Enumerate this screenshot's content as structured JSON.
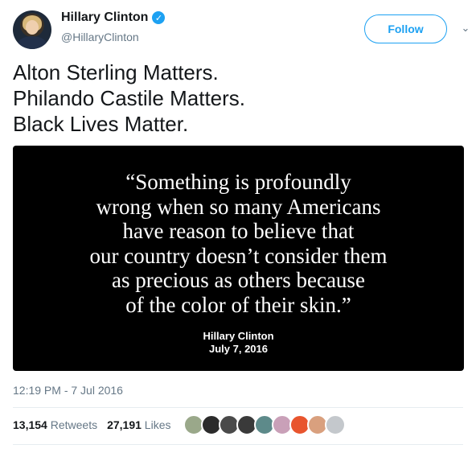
{
  "user": {
    "display_name": "Hillary Clinton",
    "handle": "@HillaryClinton",
    "verified_glyph": "✓"
  },
  "actions": {
    "follow_label": "Follow",
    "more_glyph": "⌄"
  },
  "tweet": {
    "lines": [
      "Alton Sterling Matters.",
      "Philando Castile Matters.",
      "Black Lives Matter."
    ]
  },
  "media": {
    "quote_lines": [
      "“Something is profoundly",
      "wrong when so many Americans",
      "have reason to believe that",
      "our country doesn’t consider them",
      "as precious as others because",
      "of the color of their skin.”"
    ],
    "attribution_name": "Hillary Clinton",
    "attribution_date": "July 7, 2016"
  },
  "meta": {
    "timestamp": "12:19 PM - 7 Jul 2016"
  },
  "stats": {
    "retweets_count": "13,154",
    "retweets_label": "Retweets",
    "likes_count": "27,191",
    "likes_label": "Likes"
  },
  "likers": {
    "colors": [
      "#9aa88a",
      "#2b2b2b",
      "#4a4a4a",
      "#3a3a3a",
      "#5d8a8a",
      "#c9a0b8",
      "#e8552e",
      "#d9a07e",
      "#c4c8cc"
    ]
  },
  "colors": {
    "accent": "#1da1f2",
    "muted": "#657786",
    "text": "#14171a"
  }
}
